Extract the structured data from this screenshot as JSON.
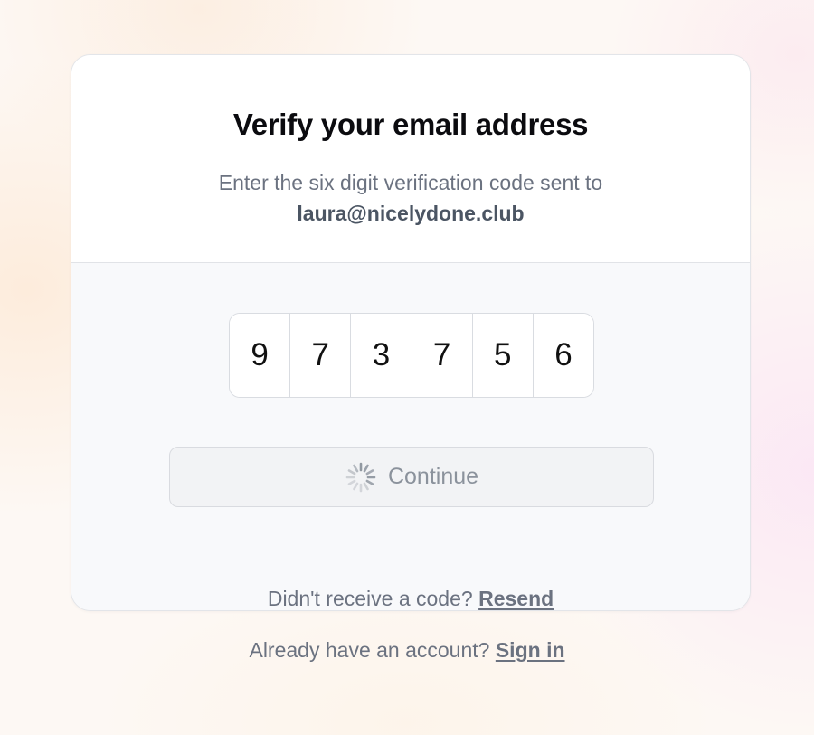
{
  "header": {
    "title": "Verify your email address",
    "subtitle": "Enter the six digit verification code sent to",
    "email": "laura@nicelydone.club"
  },
  "code": {
    "digits": [
      "9",
      "7",
      "3",
      "7",
      "5",
      "6"
    ]
  },
  "continue_button": {
    "label": "Continue",
    "state": "loading",
    "icon": "spinner-icon"
  },
  "resend": {
    "prompt": "Didn't receive a code?",
    "link_label": "Resend"
  },
  "footer": {
    "prompt": "Already have an account?",
    "link_label": "Sign in"
  },
  "colors": {
    "text_primary": "#0b0b0f",
    "text_muted": "#6b7280",
    "card_border": "#e3e5e9",
    "body_bg": "#f8f9fb",
    "button_disabled_bg": "#f2f3f5"
  }
}
